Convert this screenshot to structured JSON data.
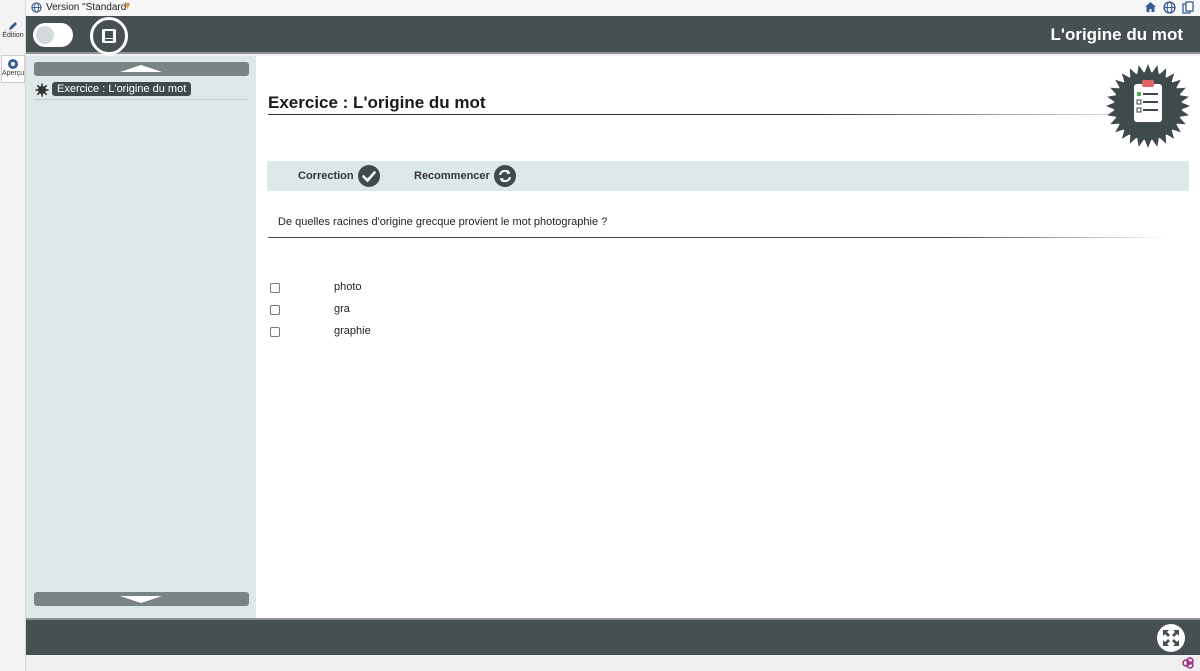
{
  "tools": {
    "edition_label": "Édition",
    "apercu_label": "Aperçu"
  },
  "version_bar": {
    "label": "Version \"Standard\"",
    "caret": "▼",
    "icons": [
      "home-icon",
      "globe-icon",
      "copy-icon"
    ]
  },
  "header": {
    "title": "L'origine du mot"
  },
  "outline": {
    "items": [
      {
        "label": "Exercice : L'origine du mot"
      }
    ]
  },
  "exercise": {
    "title": "Exercice : L'origine du mot",
    "correction_label": "Correction",
    "restart_label": "Recommencer",
    "question": "De quelles racines d'origine grecque provient le mot photographie ?",
    "answers": [
      {
        "text": "photo",
        "checked": false
      },
      {
        "text": "gra",
        "checked": false
      },
      {
        "text": "graphie",
        "checked": false
      }
    ]
  },
  "colors": {
    "header_bg": "#464f51",
    "panel_bg": "#dde9e9",
    "accent_dark": "#3f4a4c",
    "badge_red": "#e06666"
  }
}
